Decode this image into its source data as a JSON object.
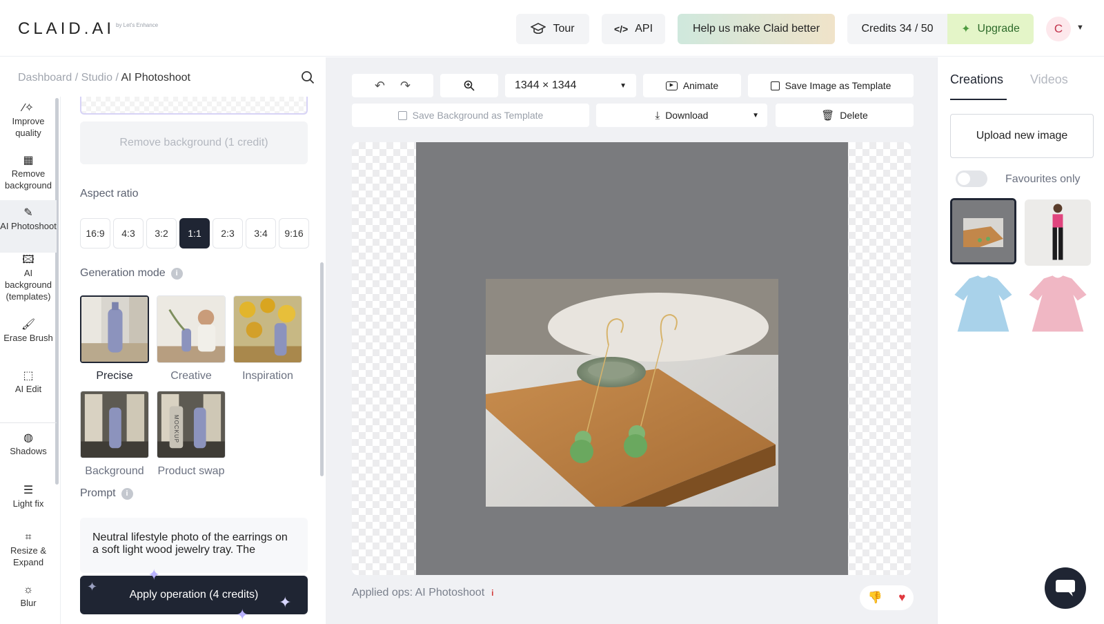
{
  "header": {
    "logo": "CLAID.AI",
    "logo_sub": "by Let's Enhance",
    "tour_label": "Tour",
    "api_label": "API",
    "help_label": "Help us make Claid better",
    "credits_label": "Credits 34 / 50",
    "upgrade_label": "Upgrade",
    "avatar_initial": "C"
  },
  "breadcrumb": {
    "dashboard": "Dashboard",
    "studio": "Studio",
    "current": "AI Photoshoot",
    "sep": "/"
  },
  "rail": {
    "items": [
      {
        "label": "Improve quality",
        "icon": "magic-wand-icon"
      },
      {
        "label": "Remove background",
        "icon": "checkerboard-icon"
      },
      {
        "label": "AI Photoshoot",
        "icon": "pen-sparkle-icon"
      },
      {
        "label": "AI background (templates)",
        "icon": "image-plus-icon"
      },
      {
        "label": "Erase Brush",
        "icon": "brush-icon"
      },
      {
        "label": "AI Edit",
        "icon": "ai-edit-icon"
      },
      {
        "label": "Shadows",
        "icon": "shadows-icon"
      },
      {
        "label": "Light fix",
        "icon": "sliders-icon"
      },
      {
        "label": "Resize & Expand",
        "icon": "crop-icon"
      },
      {
        "label": "Blur",
        "icon": "sun-icon"
      }
    ]
  },
  "panel": {
    "remove_bg_label": "Remove background (1 credit)",
    "aspect_label": "Aspect ratio",
    "ratios": [
      "16:9",
      "4:3",
      "3:2",
      "1:1",
      "2:3",
      "3:4",
      "9:16"
    ],
    "selected_ratio": "1:1",
    "generation_label": "Generation mode",
    "modes": [
      "Precise",
      "Creative",
      "Inspiration",
      "Background",
      "Product swap"
    ],
    "selected_mode": "Precise",
    "mockup_text": "MOCKUP",
    "prompt_label": "Prompt",
    "prompt_text": "Neutral lifestyle photo of the earrings on a soft light wood jewelry tray. The",
    "apply_label": "Apply operation (4 credits)"
  },
  "toolbar": {
    "size_value": "1344 × 1344",
    "animate_label": "Animate",
    "save_image_label": "Save Image as Template",
    "save_bg_label": "Save Background as Template",
    "download_label": "Download",
    "delete_label": "Delete"
  },
  "canvas": {
    "applied_ops": "Applied ops: AI Photoshoot",
    "info_mark": "i"
  },
  "right": {
    "tab_creations": "Creations",
    "tab_videos": "Videos",
    "upload_label": "Upload new image",
    "favourites_label": "Favourites only"
  },
  "colors": {
    "dark": "#1f2533",
    "accent": "#b9b2ff",
    "upgrade": "#e4f5c8"
  }
}
